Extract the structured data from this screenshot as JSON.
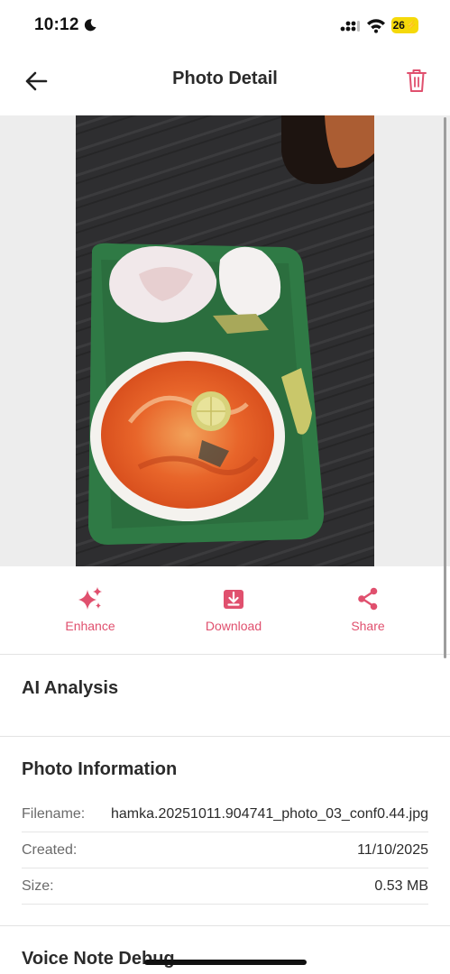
{
  "status_bar": {
    "time": "10:12",
    "battery": "26"
  },
  "header": {
    "title": "Photo Detail"
  },
  "icons": {
    "back": "arrow-left-icon",
    "delete": "trash-icon",
    "enhance": "sparkles-icon",
    "download": "download-icon",
    "share": "share-icon"
  },
  "actions": [
    {
      "label": "Enhance"
    },
    {
      "label": "Download"
    },
    {
      "label": "Share"
    }
  ],
  "sections": {
    "ai_analysis": "AI Analysis",
    "photo_information": "Photo Information",
    "voice_note_debug": "Voice Note Debug"
  },
  "photo_info": {
    "filename_label": "Filename:",
    "filename_value": "hamka.20251011.904741_photo_03_conf0.44.jpg",
    "created_label": "Created:",
    "created_value": "11/10/2025",
    "size_label": "Size:",
    "size_value": "0.53 MB"
  },
  "colors": {
    "accent": "#e0506e",
    "divider": "#e3e3e3",
    "photo_bg": "#ededed"
  }
}
